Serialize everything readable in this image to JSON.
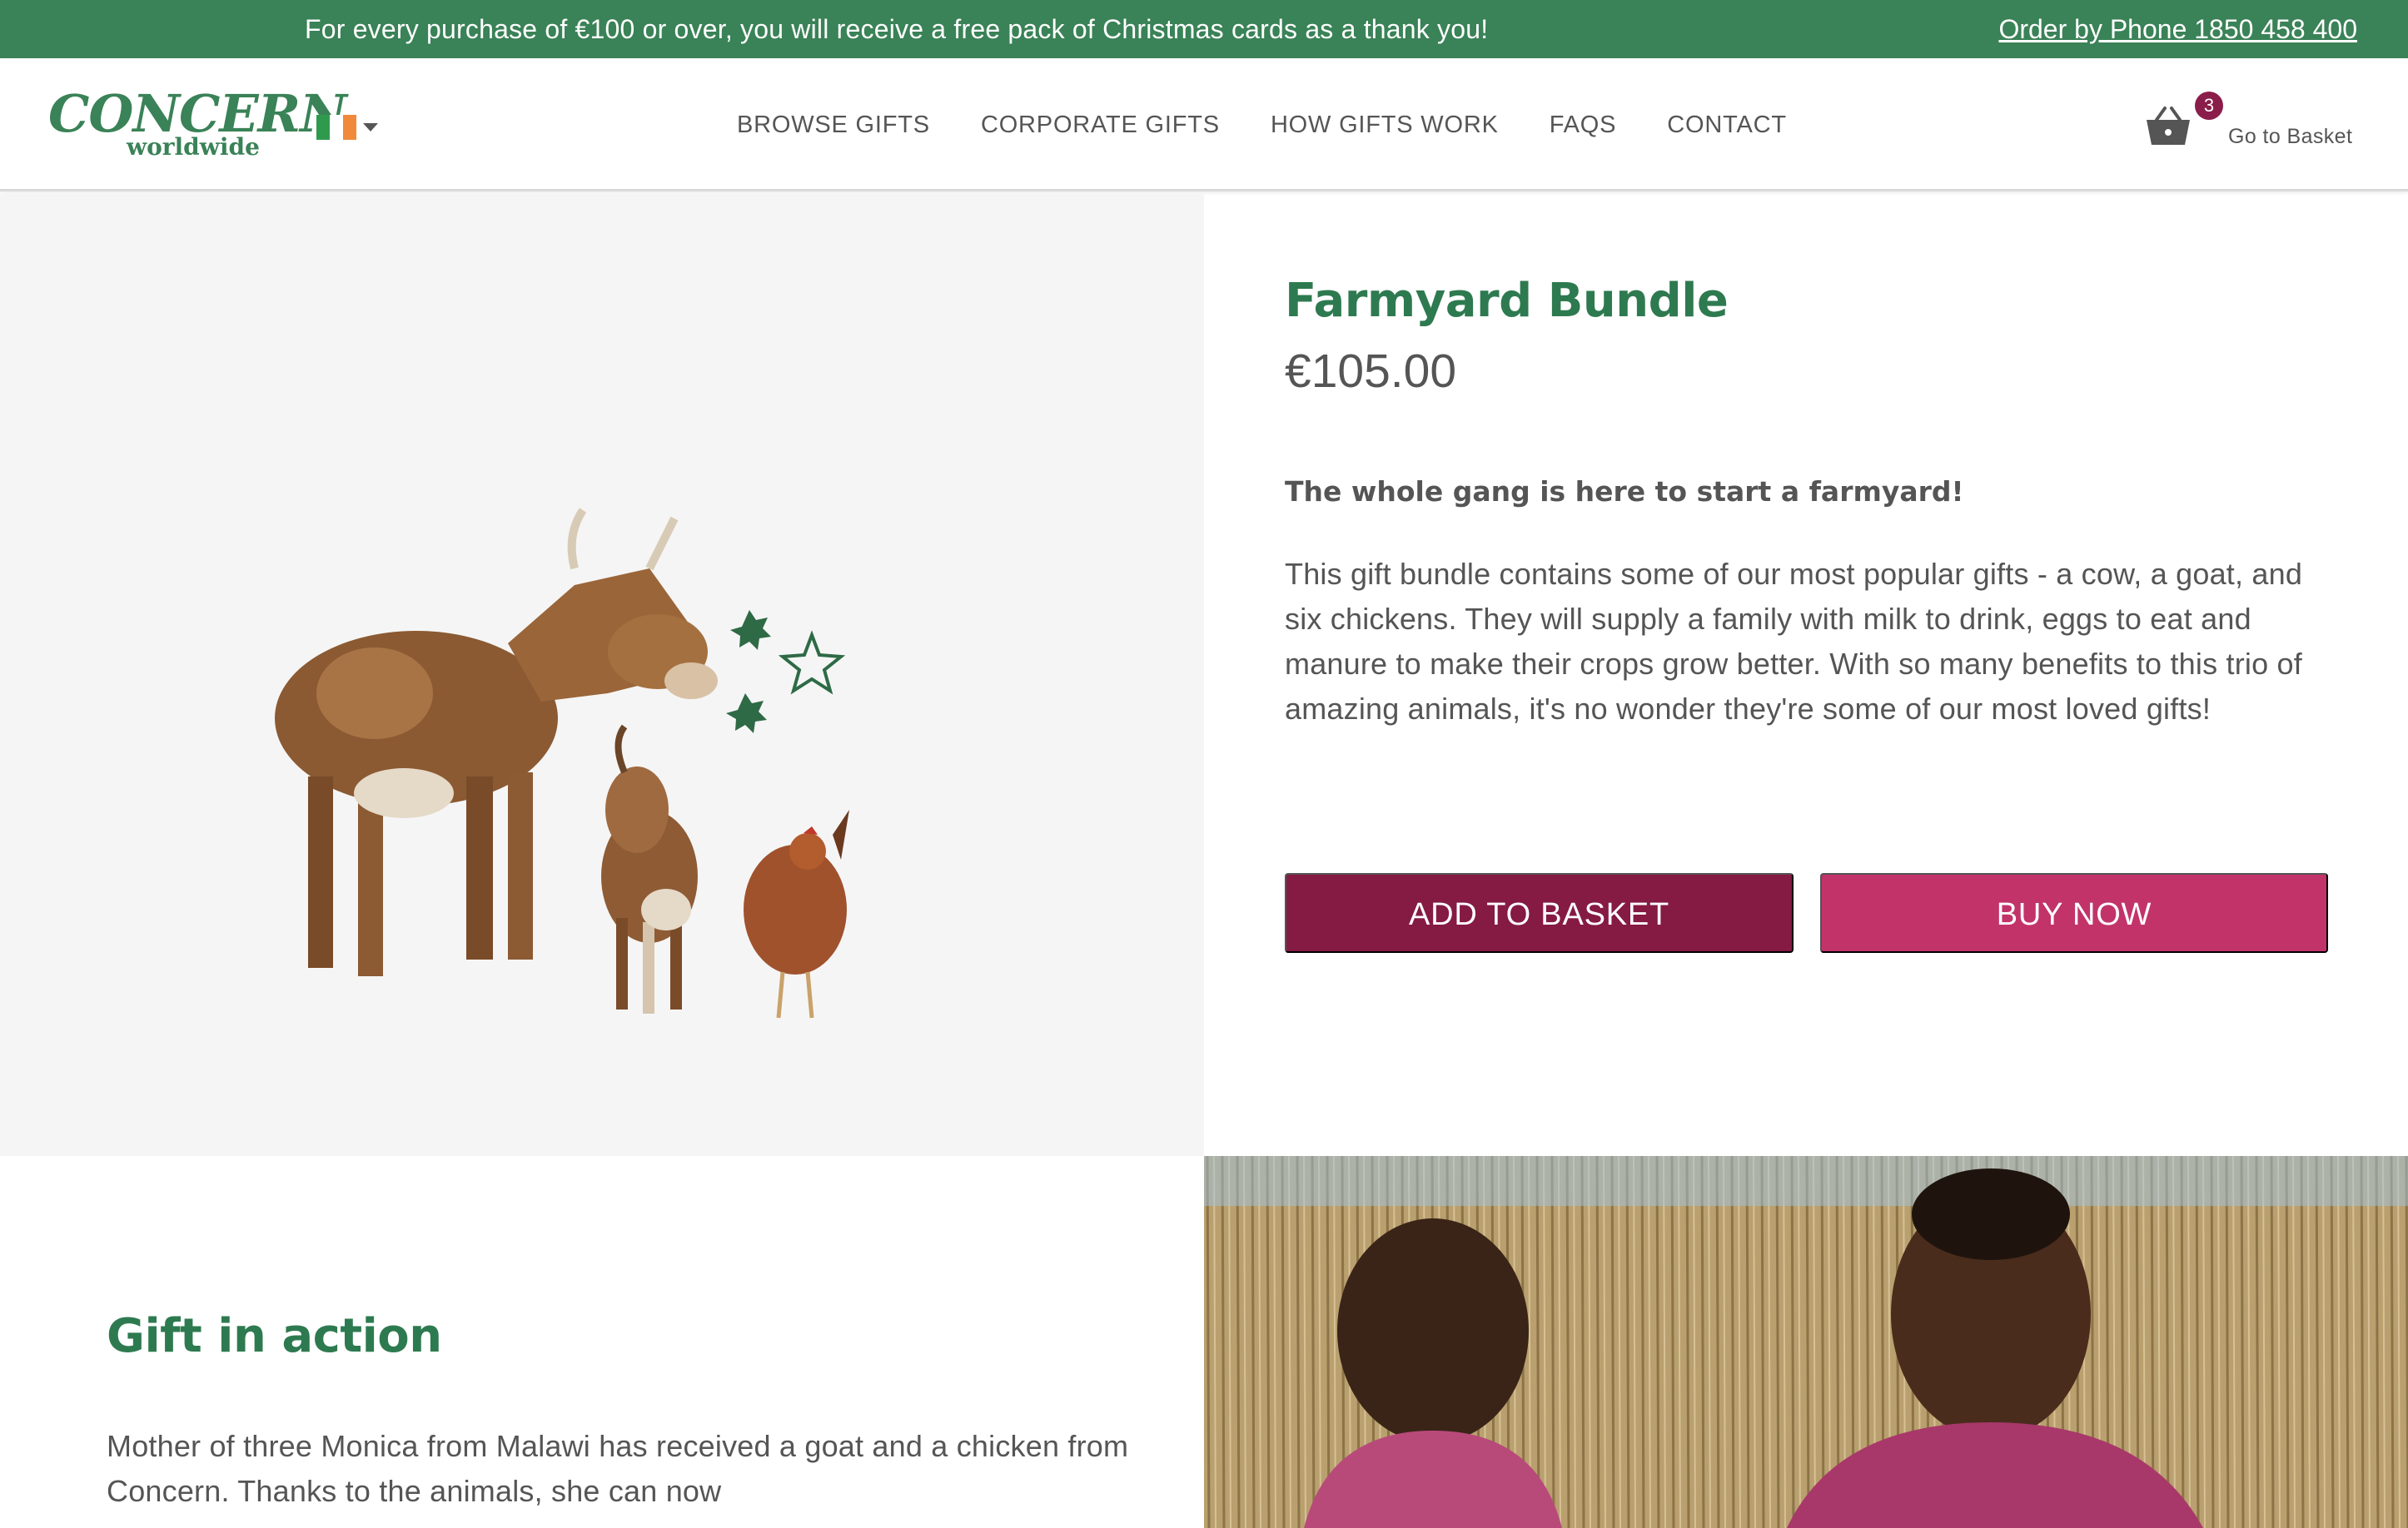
{
  "promo": {
    "text": "For every purchase of €100 or over, you will receive a free pack of Christmas cards as a thank you!",
    "phone_link": "Order by Phone 1850 458 400"
  },
  "header": {
    "logo_main": "CONCERN",
    "logo_sub": "worldwide",
    "country_flag": "ireland-flag",
    "nav": [
      "BROWSE GIFTS",
      "CORPORATE GIFTS",
      "HOW GIFTS WORK",
      "FAQS",
      "CONTACT"
    ],
    "basket_count": "3",
    "basket_label": "Go to Basket",
    "basket_icon": "basket-icon"
  },
  "product": {
    "title": "Farmyard Bundle",
    "price": "€105.00",
    "tagline": "The whole gang is here to start a farmyard!",
    "description": "This gift bundle contains some of our most popular gifts - a cow, a goat, and six chickens. They will supply a family with milk to drink, eggs to eat and manure to make their crops grow better. With so many benefits to this trio of amazing animals, it's no wonder they're some of our most loved gifts!",
    "add_to_basket": "ADD TO BASKET",
    "buy_now": "BUY NOW"
  },
  "gift_in_action": {
    "title": "Gift in action",
    "text": "Mother of three Monica from Malawi has received a goat and a chicken from Concern. Thanks to the animals, she can now"
  },
  "colors": {
    "brand_green": "#3a8257",
    "title_green": "#2e7a50",
    "add_button": "#851a43",
    "buy_button": "#c2336a",
    "badge": "#8a1d4a"
  }
}
